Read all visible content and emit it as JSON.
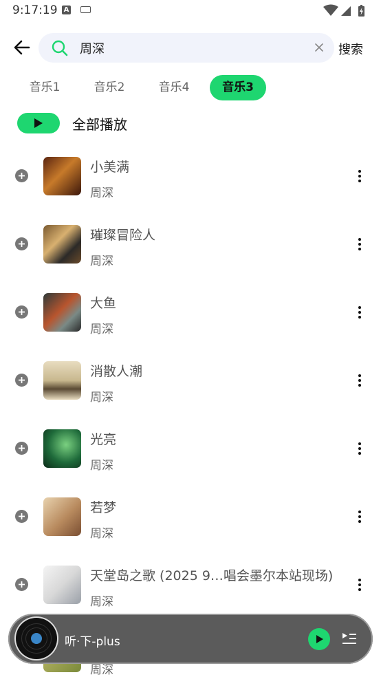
{
  "status_bar": {
    "time": "9:17:19",
    "notif_icon_a": "A"
  },
  "header": {
    "search_value": "周深",
    "search_button": "搜索"
  },
  "tabs": [
    {
      "label": "音乐1",
      "active": false
    },
    {
      "label": "音乐2",
      "active": false
    },
    {
      "label": "音乐4",
      "active": false
    },
    {
      "label": "音乐3",
      "active": true
    }
  ],
  "play_all": {
    "label": "全部播放"
  },
  "songs": [
    {
      "title": "小美满",
      "artist": "周深"
    },
    {
      "title": "璀璨冒险人",
      "artist": "周深"
    },
    {
      "title": "大鱼",
      "artist": "周深"
    },
    {
      "title": "消散人潮",
      "artist": "周深"
    },
    {
      "title": "光亮",
      "artist": "周深"
    },
    {
      "title": "若梦",
      "artist": "周深"
    },
    {
      "title": "天堂岛之歌 (2025 9…唱会墨尔本站现场)",
      "artist": "周深"
    },
    {
      "title": "",
      "artist": "周深"
    }
  ],
  "player": {
    "title": "听·下-plus"
  },
  "colors": {
    "accent": "#1ed670",
    "player_bg": "#5b5b5b"
  },
  "icons": [
    "back-arrow-icon",
    "search-icon",
    "clear-icon",
    "play-icon",
    "add-circle-icon",
    "more-vertical-icon",
    "vinyl-disc-icon",
    "playlist-icon",
    "wifi-icon",
    "signal-icon",
    "battery-icon"
  ]
}
